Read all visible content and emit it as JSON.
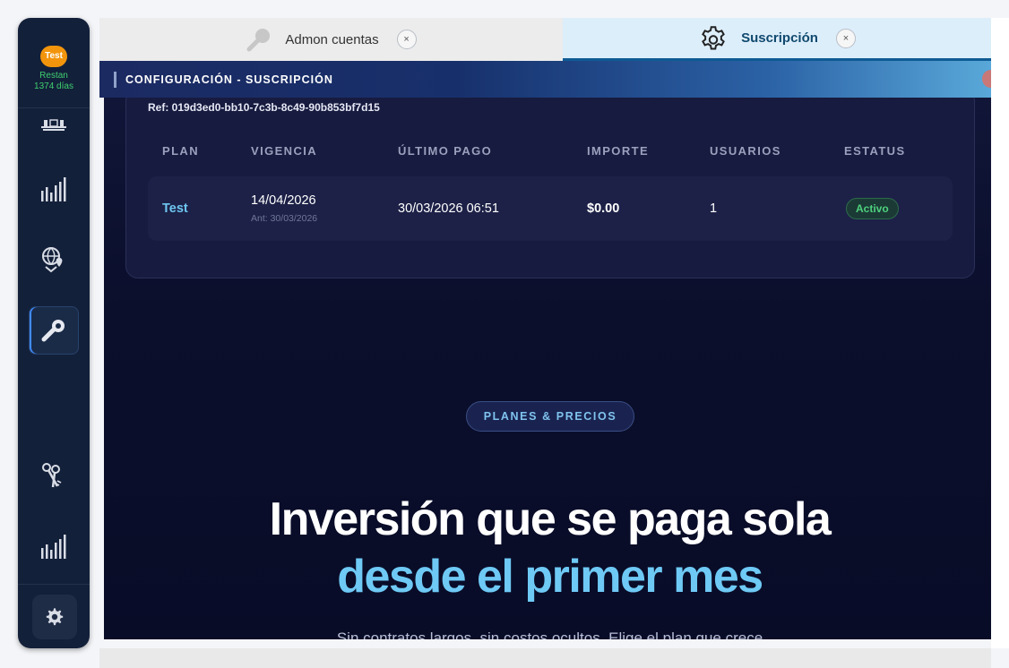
{
  "sidebar": {
    "avatar_label": "Test",
    "days_left_line1": "Restan",
    "days_left_line2": "1374 días"
  },
  "tabs": [
    {
      "label": "Admon cuentas",
      "icon": "key-icon",
      "close": "×"
    },
    {
      "label": "Suscripción",
      "icon": "gear-icon",
      "close": "×",
      "active": true
    }
  ],
  "header": {
    "title": "CONFIGURACIÓN - SUSCRIPCIÓN"
  },
  "subscription": {
    "ref": "Ref: 019d3ed0-bb10-7c3b-8c49-90b853bf7d15",
    "columns": [
      "PLAN",
      "VIGENCIA",
      "ÚLTIMO PAGO",
      "IMPORTE",
      "USUARIOS",
      "ESTATUS"
    ],
    "row": {
      "plan": "Test",
      "vigencia": "14/04/2026",
      "vigencia_prev": "Ant: 30/03/2026",
      "ultimo_pago": "30/03/2026 06:51",
      "importe": "$0.00",
      "usuarios": "1",
      "estatus": "Activo"
    }
  },
  "pricing": {
    "pill": "PLANES & PRECIOS",
    "headline_1": "Inversión que se paga sola",
    "headline_2": "desde el primer mes",
    "subtitle": "Sin contratos largos, sin costos ocultos. Elige el plan que crece"
  },
  "colors": {
    "accent": "#6ec9f5",
    "sidebar": "#13203a",
    "badge_green": "#4ed17d",
    "avatar": "#f2950c"
  }
}
